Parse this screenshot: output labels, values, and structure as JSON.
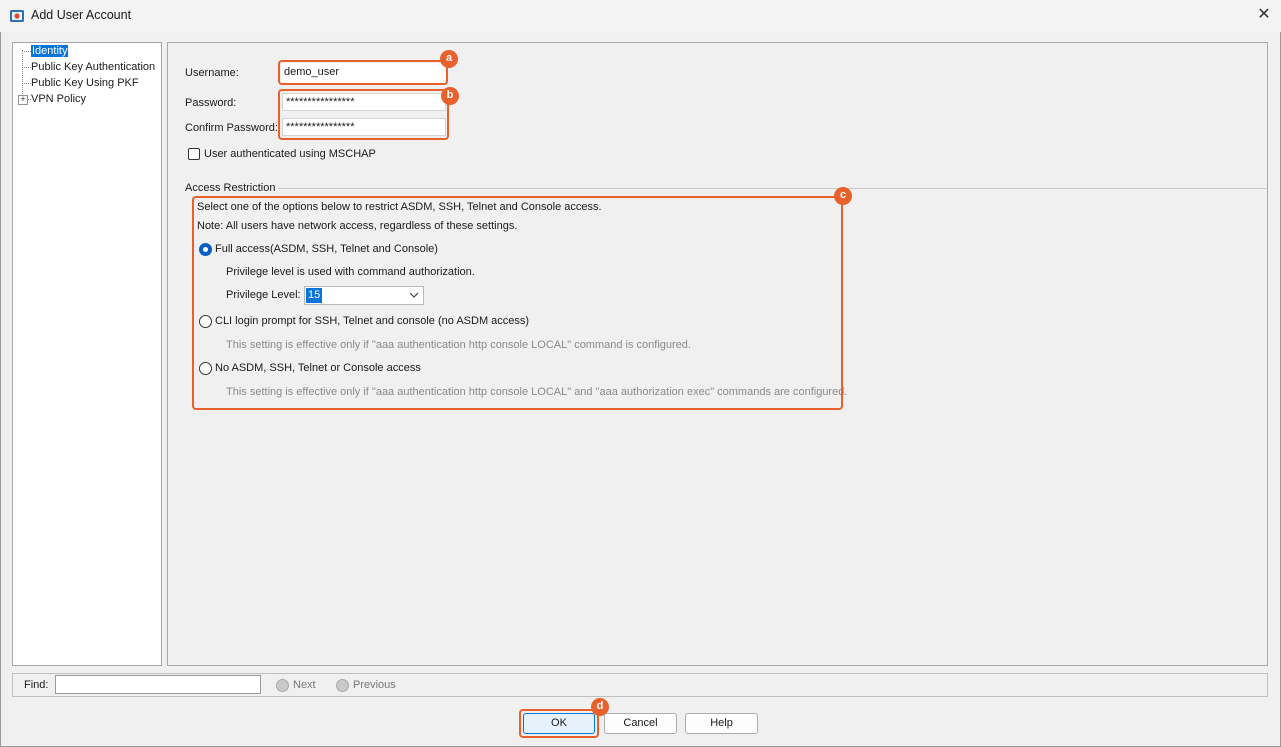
{
  "window": {
    "title": "Add User Account"
  },
  "tree": {
    "items": [
      {
        "label": "Identity",
        "selected": true
      },
      {
        "label": "Public Key Authentication"
      },
      {
        "label": "Public Key Using PKF"
      },
      {
        "label": "VPN Policy",
        "expandable": true
      }
    ],
    "expander_glyph": "+"
  },
  "identity": {
    "username_label": "Username:",
    "username_value": "demo_user",
    "password_label": "Password:",
    "password_value": "****************",
    "confirm_label": "Confirm Password:",
    "confirm_value": "****************",
    "mschap_label": "User authenticated using MSCHAP",
    "mschap_checked": false
  },
  "access": {
    "section_title": "Access Restriction",
    "intro": "Select one of the options below to restrict ASDM, SSH, Telnet and Console access.",
    "note": "Note: All users have network access, regardless of these settings.",
    "option_full": "Full access(ASDM, SSH, Telnet and Console)",
    "privilege_note": "Privilege level is used with command authorization.",
    "privilege_label": "Privilege Level:",
    "privilege_value": "15",
    "option_cli": "CLI login prompt for SSH, Telnet and console (no ASDM access)",
    "cli_note": "This setting is effective only if \"aaa authentication http console LOCAL\" command is configured.",
    "option_none": "No ASDM, SSH, Telnet or Console access",
    "none_note": "This setting is effective only if \"aaa authentication http console LOCAL\" and \"aaa authorization exec\" commands are configured.",
    "selected": "full"
  },
  "annotations": {
    "a": "a",
    "b": "b",
    "c": "c",
    "d": "d"
  },
  "find": {
    "label": "Find:",
    "value": "",
    "next": "Next",
    "previous": "Previous"
  },
  "buttons": {
    "ok": "OK",
    "cancel": "Cancel",
    "help": "Help"
  },
  "colors": {
    "accent": "#e8602c",
    "selection": "#0a74da",
    "radio_on": "#0a5fc4"
  }
}
